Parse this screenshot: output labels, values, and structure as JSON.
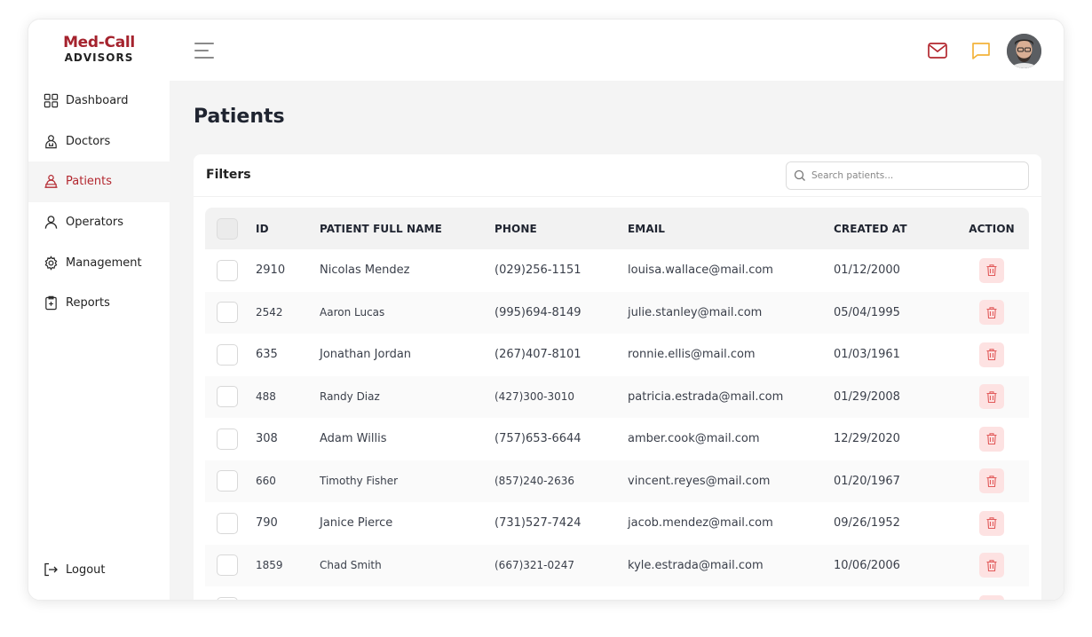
{
  "brand": {
    "name_top": "Med-Call",
    "name_bottom": "ADVISORS",
    "accent": "#b3272f"
  },
  "sidebar": {
    "items": [
      {
        "label": "Dashboard",
        "icon": "grid-icon"
      },
      {
        "label": "Doctors",
        "icon": "doctor-icon"
      },
      {
        "label": "Patients",
        "icon": "patient-icon",
        "active": true
      },
      {
        "label": "Operators",
        "icon": "user-icon"
      },
      {
        "label": "Management",
        "icon": "gear-icon"
      },
      {
        "label": "Reports",
        "icon": "clipboard-icon"
      }
    ],
    "logout": "Logout"
  },
  "topbar": {
    "icons": [
      "menu-icon",
      "mail-icon",
      "chat-icon",
      "avatar"
    ]
  },
  "page": {
    "title": "Patients"
  },
  "filters": {
    "label": "Filters",
    "search_placeholder": "Search patients..."
  },
  "table": {
    "headers": [
      "ID",
      "PATIENT FULL NAME",
      "PHONE",
      "EMAIL",
      "CREATED AT",
      "ACTION"
    ],
    "rows": [
      {
        "id": "2910",
        "name": "Nicolas Mendez",
        "phone": "(029)256-1151",
        "email": "louisa.wallace@mail.com",
        "created": "01/12/2000"
      },
      {
        "id": "2542",
        "name": "Aaron Lucas",
        "phone": "(995)694-8149",
        "email": "julie.stanley@mail.com",
        "created": "05/04/1995"
      },
      {
        "id": "635",
        "name": "Jonathan Jordan",
        "phone": "(267)407-8101",
        "email": "ronnie.ellis@mail.com",
        "created": "01/03/1961"
      },
      {
        "id": "488",
        "name": "Randy Diaz",
        "phone": "(427)300-3010",
        "email": "patricia.estrada@mail.com",
        "created": "01/29/2008"
      },
      {
        "id": "308",
        "name": "Adam Willis",
        "phone": "(757)653-6644",
        "email": "amber.cook@mail.com",
        "created": "12/29/2020"
      },
      {
        "id": "660",
        "name": "Timothy Fisher",
        "phone": "(857)240-2636",
        "email": "vincent.reyes@mail.com",
        "created": "01/20/1967"
      },
      {
        "id": "790",
        "name": "Janice Pierce",
        "phone": "(731)527-7424",
        "email": "jacob.mendez@mail.com",
        "created": "09/26/1952"
      },
      {
        "id": "1859",
        "name": "Chad Smith",
        "phone": "(667)321-0247",
        "email": "kyle.estrada@mail.com",
        "created": "10/06/2006"
      },
      {
        "id": "",
        "name": "",
        "phone": "",
        "email": "",
        "created": ""
      }
    ]
  }
}
